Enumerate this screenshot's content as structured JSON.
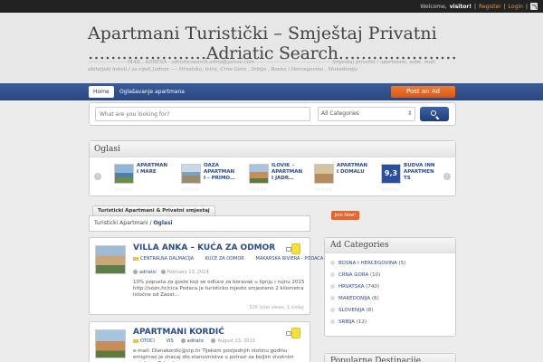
{
  "topbar": {
    "welcome": "Welcome,",
    "user": "visitor!",
    "sep1": "|",
    "register": "Register",
    "sep2": "|",
    "login": "Login",
    "sep3": "|"
  },
  "header": {
    "title_line1": "Apartmani Turistički – Smještaj Privatni",
    "title_line2": "…………………Adriatic Search…………………",
    "tagline": "————————MAIL, ADRESA - adriaticsearch.adria@yahoo.com ——————————————— Smještaj privatni / apartmani, sobe, mali obiteljski hoteli / za cijeli Jadran —- Hrvatska, Istra, Crne Gora , Srbija , Bosna i Hercegovina , Makedonija"
  },
  "nav": {
    "home": "Home",
    "item1": "Oglašavanje apartmana",
    "post_ad": "Post an Ad"
  },
  "search": {
    "placeholder": "What are you looking for?",
    "category": "All Categories"
  },
  "oglasi": {
    "title": "Oglasi",
    "items": [
      {
        "title": "APARTMAN I MARE"
      },
      {
        "title": "OAZA APARTMAN I – PRIMO…"
      },
      {
        "title": "ILOVIK – APARTMAN I JADR…"
      },
      {
        "title": "APARTMAN I DOMALU"
      },
      {
        "title": "BUDVA INN APARTMEN TS",
        "score": "9,3"
      }
    ]
  },
  "tabs": {
    "tab1": "Turisticki Apartmani & Privatni smjestaj"
  },
  "breadcrumb": {
    "root": "Turisticki Apartmani",
    "sep": " / ",
    "current": "Oglasi"
  },
  "listings": [
    {
      "title": "VILLA ANKA – KUĆA ZA ODMOR",
      "cat1": "CENTRALNA DALMACIJA",
      "cat2": "KUCE ZA ODMOR",
      "cat3": "MAKARSKA RIVIERA - PODACA",
      "author": "adriatic",
      "date": "February 13, 2014",
      "desc": "10% popusta  za goste koji se odluce za boravak u  lipnju  i rujnu 2015 http://sozn.hr/cica Podaca je turisticko mjesto smjesteno 2 kilometra istočne od Zaost…",
      "views": "526 total views, 1 today"
    },
    {
      "title": "APARTMANI KORDIĆ",
      "cat1": "OTOCI",
      "cat2": "VIS",
      "author": "adriatic",
      "date": "August 13, 2013",
      "desc": "e-mail: Dianakordic@vip.hr Tijekom posljednjih stotinu godinu emigriraо je znacaj dio stanovnistva u potrazi za boljim zivotnim uvjetima. Tako danas u"
    }
  ],
  "sidebar": {
    "join": "Join Now!",
    "categories_title": "Ad Categories",
    "categories": [
      {
        "name": "BOSNA I HERCEGOVINA",
        "count": "(5)"
      },
      {
        "name": "CRNA GORA",
        "count": "(10)"
      },
      {
        "name": "HRVATSKA",
        "count": "(740)"
      },
      {
        "name": "MAKEDONIJA",
        "count": "(6)"
      },
      {
        "name": "SLOVENIJA",
        "count": "(8)"
      },
      {
        "name": "SRBIJA",
        "count": "(12)"
      }
    ],
    "popular_title": "Popularne Destinacije"
  },
  "colors": {
    "nav": "#2a4780",
    "accent": "#e8642a",
    "link": "#2a4a8a"
  }
}
